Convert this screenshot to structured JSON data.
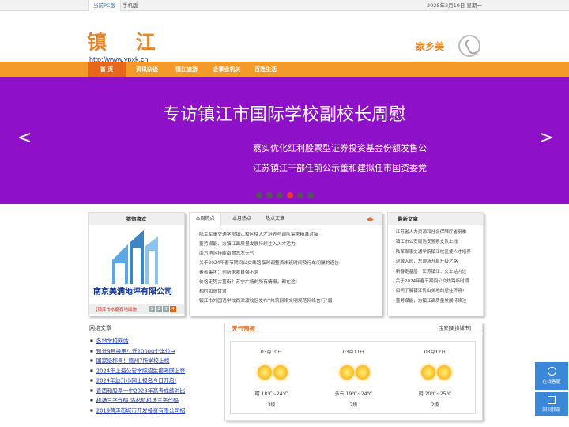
{
  "topbar": {
    "pc_label": "当前PC版",
    "mobile_label": "手机版",
    "date": "2025年3月10日 星期一"
  },
  "header": {
    "logo_text": "镇 江",
    "url": "http://www.ypxk.cn",
    "slogan": "家乡美",
    "phone_icon": "phone-icon"
  },
  "nav": {
    "items": [
      "首 页",
      "资讯杂谈",
      "镇江旅游",
      "企事业机关",
      "百姓生活"
    ]
  },
  "banner": {
    "title": "专访镇江市国际学校副校长周慰",
    "lines": [
      "嘉实优化红利股票型证券投资基金份额发售公",
      "江苏镇江干部任前公示董和建拟任市国资委党"
    ],
    "prev": "<",
    "next": ">",
    "dot_count": 6,
    "active_dot": 3
  },
  "pic_section": {
    "title": "猜你喜欢",
    "company": "南京美满地坪有限公司",
    "caption": "【镇江市水磨石地面施",
    "pages": [
      "1",
      "2",
      "3",
      "4"
    ]
  },
  "news_tabs": {
    "tabs": [
      "本周热点",
      "本月热点",
      "热点文章"
    ],
    "items": [
      "陆军军事交通学院镇江校区使人才培养与部队需求精准对接",
      "董劳媒能、方镇江面质量发展持续注入入才活力",
      "南方地区持续南雪冻冻天气",
      "关于2024年春节期间公交线路临时调整首末班时间及行车间隔的通告",
      "素者集团：创新求索自强不息",
      "价格走势古董街？苏宁广场的所有情报，都在这!",
      "相约如意甘肃",
      "镇江市外国语学校西津渡校区发布“共筑网络文明规范网络言行”倡"
    ]
  },
  "articles": {
    "title": "最新文章",
    "items": [
      "江苏省人力资源和社会保障厅省厨季",
      "镇江市公安局治安警察支队上线",
      "陆军军事交通学院镇江校区使人才培养",
      "退城入园，东顶场开启升级之路",
      "新春走基层丨江苏镇江：火车站内过",
      "关于2024年春节期间公交线路临时调",
      "如何了解镇江优山美地的居住环境?",
      "董劳媒能，为镇江高质量发展持续注"
    ]
  },
  "links": {
    "title": "网络文章",
    "items": [
      "各地学校网站",
      "预计9月投用！近20000个学位→",
      "国家级称号！赣州7所学校上榜",
      "2024年上海公安学院招生报考网上登",
      "2024年幼升小网上报名今日开启!",
      "青西和股票一中2023年高考成绩对比",
      "机场三字代码 洛杉矶机场三字代码",
      "2019菏泽市城市开发投资有限公司招"
    ]
  },
  "weather": {
    "title": "天气预报",
    "city": "宝安[更换城市]",
    "days": [
      {
        "date": "03月10日",
        "desc": "晴 18℃~24℃",
        "wind": "3级"
      },
      {
        "date": "03月11日",
        "desc": "多云 19℃~24℃",
        "wind": "2级"
      },
      {
        "date": "03月12日",
        "desc": "阴 20℃~25℃",
        "wind": "2级"
      }
    ]
  },
  "side": {
    "consult": "在线客服",
    "top": "回到顶部"
  },
  "colors": {
    "nav": "#f39a2b",
    "banner": "#8e10c8",
    "accent": "#e8671c",
    "link": "#1d3cc9",
    "side": "#3b87d8"
  }
}
